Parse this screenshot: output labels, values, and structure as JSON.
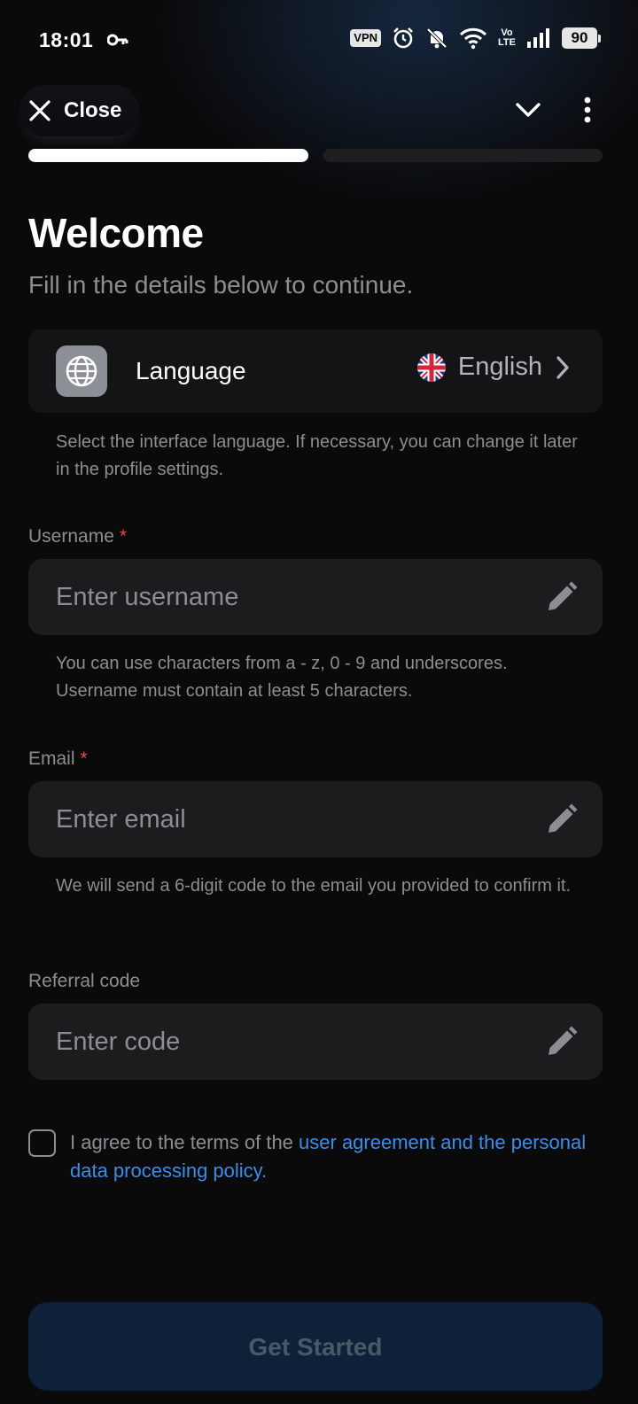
{
  "status_bar": {
    "time": "18:01",
    "vpn": "VPN",
    "volte_top": "Vo",
    "volte_bottom": "LTE",
    "battery": "90",
    "icons": [
      "key-icon",
      "alarm-icon",
      "bell-off-icon",
      "wifi-icon",
      "signal-icon",
      "battery-icon"
    ]
  },
  "top_bar": {
    "close_label": "Close",
    "icons": [
      "close-icon",
      "chevron-down-icon",
      "more-vertical-icon"
    ]
  },
  "progress": {
    "steps_total": 2,
    "current_step": 1
  },
  "header": {
    "title": "Welcome",
    "subtitle": "Fill in the details below to continue."
  },
  "language": {
    "label": "Language",
    "value": "English",
    "flag": "uk-flag-icon",
    "help": "Select the interface language. If necessary, you can change it later in the profile settings."
  },
  "fields": {
    "username": {
      "label": "Username",
      "required_mark": "*",
      "placeholder": "Enter username",
      "value": "",
      "helper": "You can use characters from a - z, 0 - 9 and underscores. Username must contain at least 5 characters."
    },
    "email": {
      "label": "Email",
      "required_mark": "*",
      "placeholder": "Enter email",
      "value": "",
      "helper": "We will send a 6-digit code to the email you provided to confirm it."
    },
    "referral": {
      "label": "Referral code",
      "placeholder": "Enter code",
      "value": ""
    }
  },
  "agreement": {
    "checked": false,
    "text": "I agree to the terms of the ",
    "link": "user agreement and the personal data processing policy",
    "suffix": "."
  },
  "cta": {
    "label": "Get Started",
    "enabled": false
  },
  "colors": {
    "background": "#0a0a0b",
    "surface": "#1c1c1e",
    "accent_link": "#3d8ce8",
    "required": "#e5484d",
    "cta_disabled_bg": "#0d2238",
    "muted_text": "#8d8d92"
  }
}
